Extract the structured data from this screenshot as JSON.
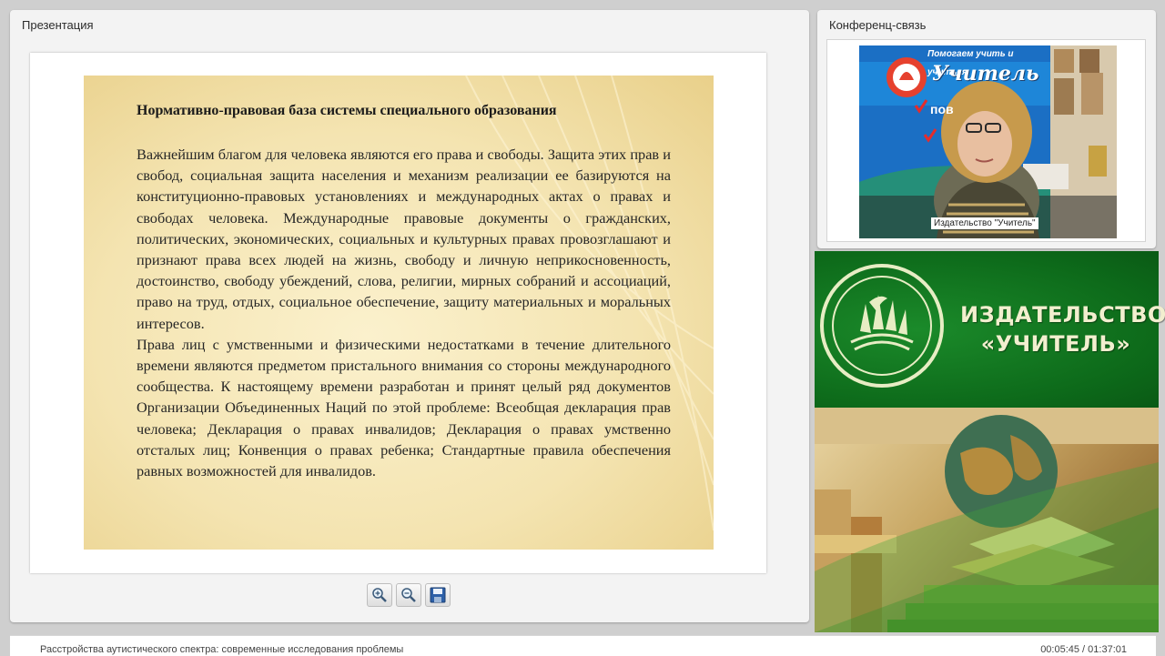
{
  "presentation": {
    "panel_title": "Презентация",
    "slide": {
      "heading": "Нормативно-правовая база системы специального образования",
      "paragraphs": [
        "Важнейшим благом для человека являются его права и свободы. Защита этих прав и свобод, социальная защита населения и механизм реализации ее базируются на конституционно-правовых установлениях и международных актах о правах и свободах человека. Международные правовые документы о гражданских, политических, экономических, социальных и культурных правах провозглашают и признают права всех людей на жизнь, свободу и личную неприкосновенность, достоинство, свободу убеждений, слова, религии, мирных собраний и ассоциаций, право на труд, отдых, социальное обеспечение, защиту материальных и моральных интересов.",
        "Права лиц с умственными и физическими недостатками в течение длительного времени являются предметом пристального внимания со стороны международного сообщества. К настоящему времени разработан и принят целый ряд документов Организации Объединенных Наций по этой проблеме: Всеобщая декларация прав человека; Декларация о правах инвалидов; Декларация о правах умственно отсталых лиц; Конвенция о правах ребенка; Стандартные правила обеспечения равных возможностей для инвалидов."
      ]
    },
    "toolbar": {
      "buttons": [
        "zoom-in-icon",
        "zoom-out-icon",
        "save-icon"
      ]
    }
  },
  "conference": {
    "panel_title": "Конференц-связь",
    "video_label": "Издательство \"Учитель\"",
    "banner_text": "Помогаем учить и учиться",
    "banner_brand": "Учитель",
    "banner_item": "пов"
  },
  "publisher": {
    "line1": "ИЗДАТЕЛЬСТВО",
    "line2": "«УЧИТЕЛЬ»"
  },
  "footer": {
    "title": "Расстройства аутистического спектра: современные исследования проблемы",
    "time": "00:05:45 / 01:37:01"
  },
  "colors": {
    "brand_green": "#0d6a1a",
    "slide_gold": "#f4e4b1",
    "panel_bg": "#f3f3f3"
  }
}
